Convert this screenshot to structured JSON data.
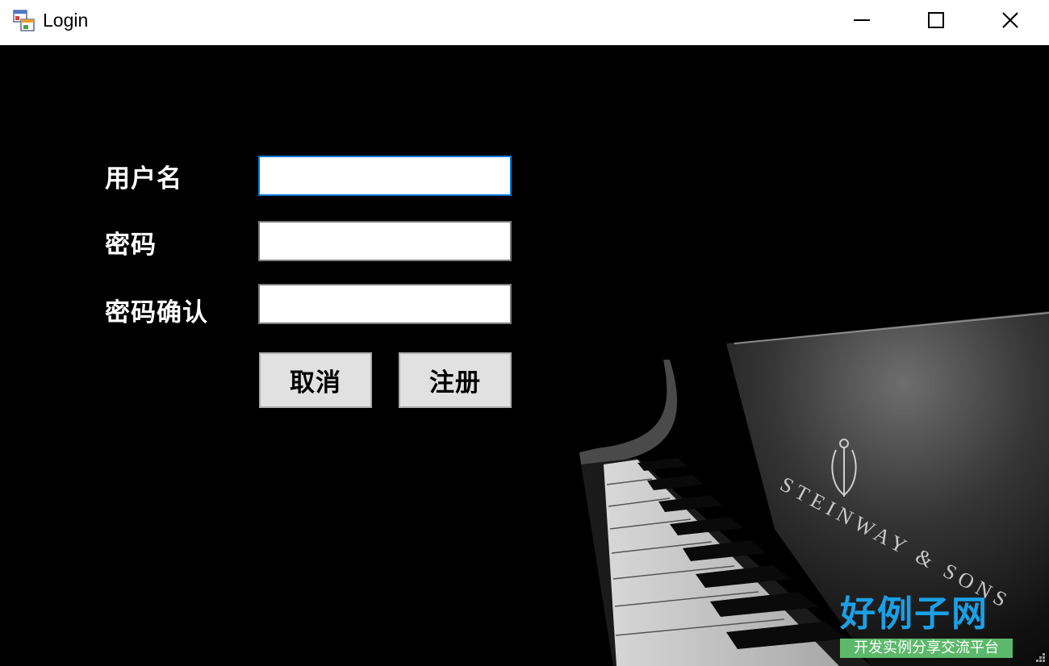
{
  "window": {
    "title": "Login",
    "icon": "app-form-icon",
    "controls": [
      "minimize-icon",
      "maximize-icon",
      "close-icon"
    ]
  },
  "form": {
    "username_label": "用户名",
    "username_value": "",
    "password_label": "密码",
    "password_value": "",
    "confirm_label": "密码确认",
    "confirm_value": "",
    "cancel_label": "取消",
    "register_label": "注册"
  },
  "background": {
    "piano_brand": "STEINWAY & SONS"
  },
  "watermark": {
    "main": "好例子网",
    "sub": "开发实例分享交流平台"
  },
  "colors": {
    "background": "#000000",
    "focus_border": "#0078d7",
    "button_face": "#e1e1e1",
    "watermark_blue": "#1aa0e6",
    "watermark_green": "#5cb86a"
  }
}
